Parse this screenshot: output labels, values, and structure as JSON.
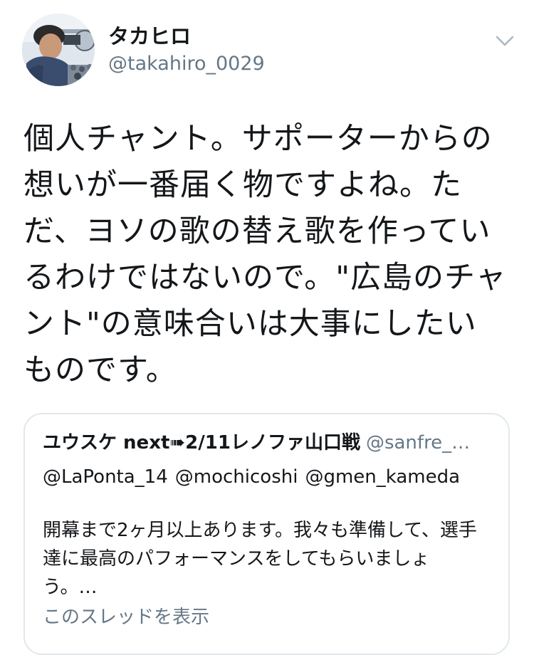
{
  "author": {
    "display_name": "タカヒロ",
    "handle": "@takahiro_0029",
    "avatar_icon": "profile-photo"
  },
  "menu": {
    "icon": "chevron-down-icon"
  },
  "tweet": {
    "text": "個人チャント。サポーターからの想いが一番届く物ですよね。ただ、ヨソの歌の替え歌を作っているわけではないので。\"広島のチャント\"の意味合いは大事にしたいものです。"
  },
  "quoted_tweet": {
    "display_name": "ユウスケ next➠2/11レノファ山口戦",
    "handle": "@sanfre_…",
    "mentions": [
      "@LaPonta_14",
      "@mochicoshi",
      "@gmen_kameda"
    ],
    "text": "開幕まで2ヶ月以上あります。我々も準備して、選手達に最高のパフォーマンスをしてもらいましょう。…",
    "thread_link": "このスレッドを表示"
  },
  "colors": {
    "text_primary": "#14171a",
    "text_secondary": "#657786",
    "border": "#e1e8ed",
    "background": "#ffffff"
  }
}
